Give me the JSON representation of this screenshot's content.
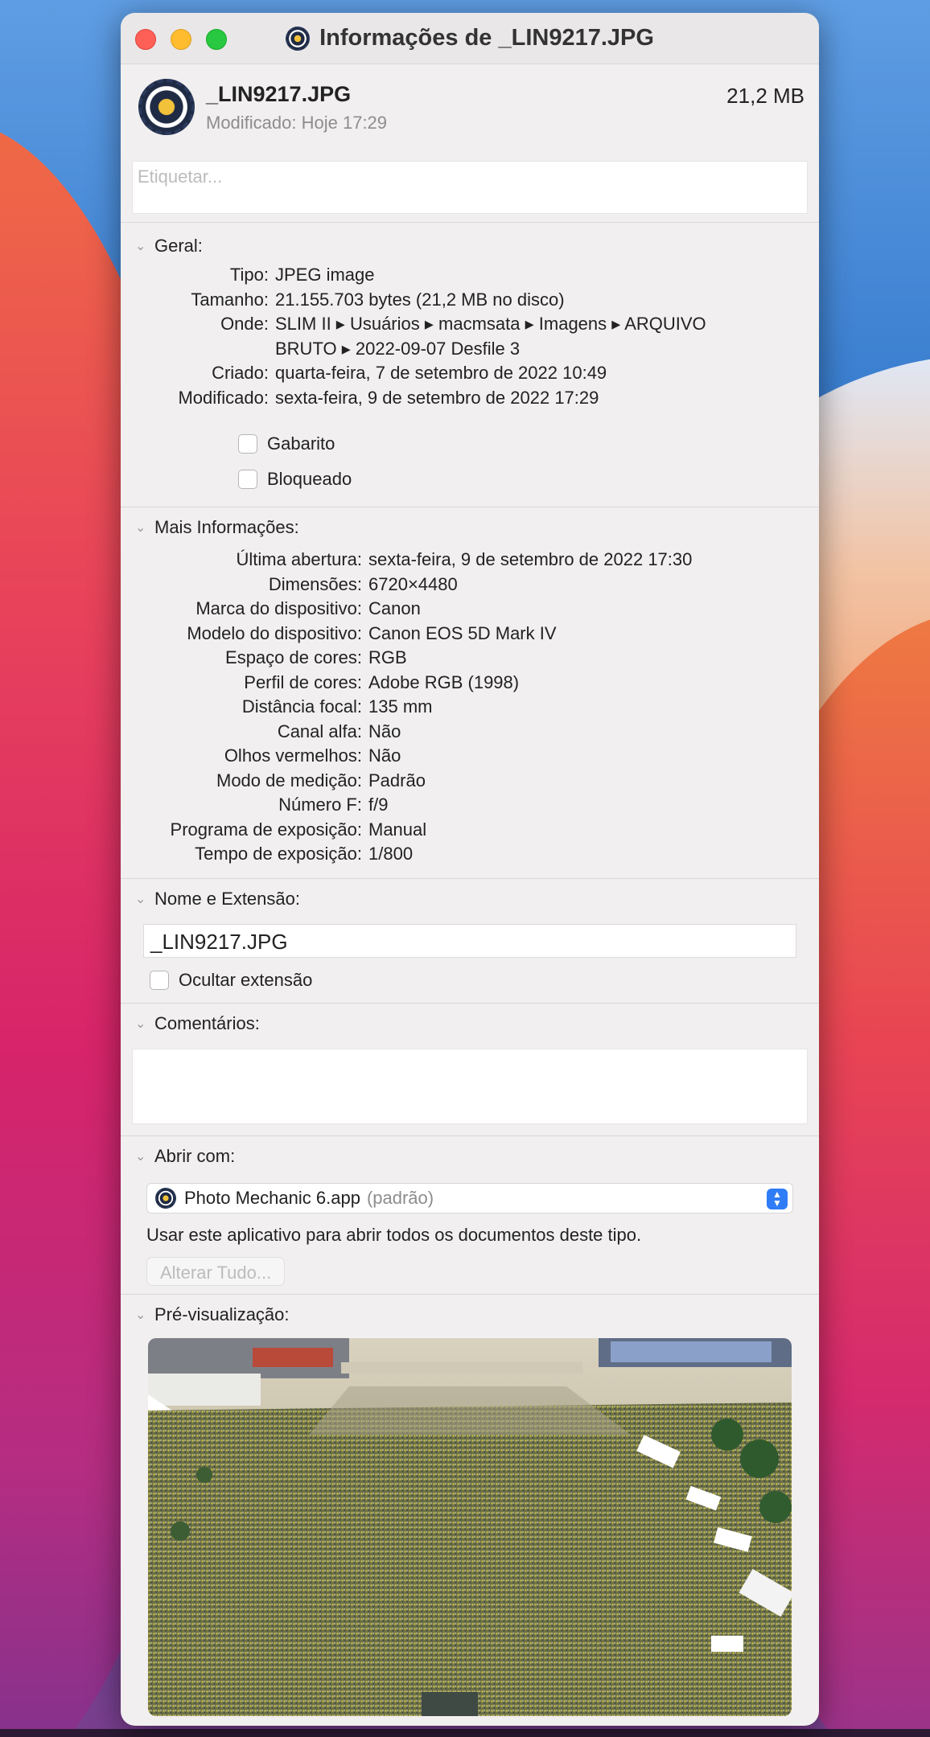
{
  "window": {
    "title": "Informações de _LIN9217.JPG"
  },
  "header": {
    "file_name": "_LIN9217.JPG",
    "modified": "Modificado: Hoje 17:29",
    "size": "21,2 MB",
    "tags_placeholder": "Etiquetar..."
  },
  "geral": {
    "title": "Geral:",
    "rows": [
      {
        "k": "Tipo:",
        "v": "JPEG image"
      },
      {
        "k": "Tamanho:",
        "v": "21.155.703 bytes (21,2 MB no disco)"
      },
      {
        "k": "Onde:",
        "v": "SLIM II ▸ Usuários ▸ macmsata ▸ Imagens ▸ ARQUIVO"
      },
      {
        "k": "",
        "v": "BRUTO ▸ 2022-09-07 Desfile 3"
      },
      {
        "k": "Criado:",
        "v": "quarta-feira, 7 de setembro de 2022 10:49"
      },
      {
        "k": "Modificado:",
        "v": "sexta-feira, 9 de setembro de 2022 17:29"
      }
    ],
    "gabarito": "Gabarito",
    "bloqueado": "Bloqueado"
  },
  "mais": {
    "title": "Mais Informações:",
    "rows": [
      {
        "k": "Última abertura:",
        "v": "sexta-feira, 9 de setembro de 2022 17:30"
      },
      {
        "k": "Dimensões:",
        "v": "6720×4480"
      },
      {
        "k": "Marca do dispositivo:",
        "v": "Canon"
      },
      {
        "k": "Modelo do dispositivo:",
        "v": "Canon EOS 5D Mark IV"
      },
      {
        "k": "Espaço de cores:",
        "v": "RGB"
      },
      {
        "k": "Perfil de cores:",
        "v": "Adobe RGB (1998)"
      },
      {
        "k": "Distância focal:",
        "v": "135 mm"
      },
      {
        "k": "Canal alfa:",
        "v": "Não"
      },
      {
        "k": "Olhos vermelhos:",
        "v": "Não"
      },
      {
        "k": "Modo de medição:",
        "v": "Padrão"
      },
      {
        "k": "Número F:",
        "v": "f/9"
      },
      {
        "k": "Programa de exposição:",
        "v": "Manual"
      },
      {
        "k": "Tempo de exposição:",
        "v": "1/800"
      }
    ]
  },
  "nome": {
    "title": "Nome e Extensão:",
    "value": "_LIN9217.JPG",
    "hide_ext": "Ocultar extensão"
  },
  "comentarios": {
    "title": "Comentários:"
  },
  "abrir": {
    "title": "Abrir com:",
    "app": "Photo Mechanic 6.app",
    "default_tag": "(padrão)",
    "hint": "Usar este aplicativo para abrir todos os documentos deste tipo.",
    "change_all": "Alterar Tudo..."
  },
  "preview": {
    "title": "Pré-visualização:"
  },
  "colors": {
    "accent": "#2f7df6",
    "window_bg": "#f1efef"
  }
}
